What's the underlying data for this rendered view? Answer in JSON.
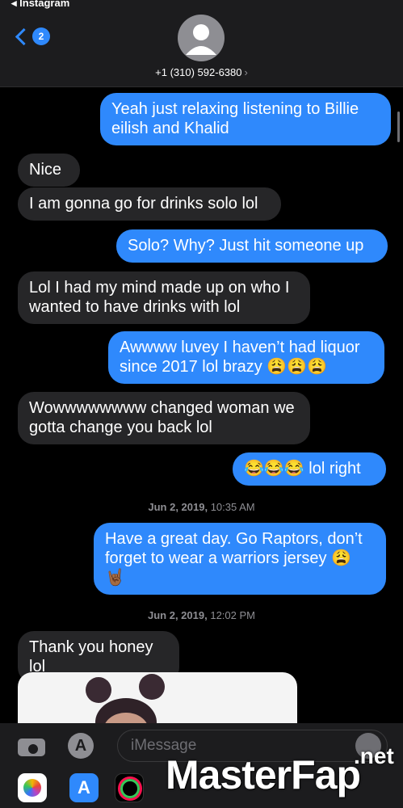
{
  "status_bar": {
    "back_app": "◂ Instagram"
  },
  "header": {
    "unread_count": "2",
    "contact": "+1 (310) 592-6380",
    "contact_chevron": "›"
  },
  "messages": [
    {
      "dir": "out",
      "text": "Yeah just relaxing listening to Billie eilish and Khalid"
    },
    {
      "dir": "in",
      "text": "Nice"
    },
    {
      "dir": "in",
      "text": "I am gonna go for drinks solo lol"
    },
    {
      "dir": "out",
      "text": "Solo? Why? Just hit someone up"
    },
    {
      "dir": "in",
      "text": "Lol I had my mind made up on who I wanted to have drinks with lol"
    },
    {
      "dir": "out",
      "text": "Awwww luvey I haven’t had liquor since 2017 lol brazy 😩😩😩"
    },
    {
      "dir": "in",
      "text": "Wowwwwwwww changed woman we gotta change you back lol"
    },
    {
      "dir": "out",
      "text": "😂😂😂 lol right"
    },
    {
      "dir": "out",
      "text": "Have a great day. Go Raptors, don’t forget to wear a warriors jersey 😩 🤘🏾"
    },
    {
      "dir": "in",
      "text": "Thank you honey lol"
    }
  ],
  "timestamps": [
    {
      "date": "Jun 2, 2019,",
      "time": "10:35 AM"
    },
    {
      "date": "Jun 2, 2019,",
      "time": "12:02 PM"
    }
  ],
  "composer": {
    "placeholder": "iMessage"
  },
  "watermark": {
    "text": "MasterFap",
    "suffix": ".net"
  },
  "colors": {
    "outgoing": "#2f89fc",
    "incoming": "#262628",
    "background": "#000000"
  }
}
